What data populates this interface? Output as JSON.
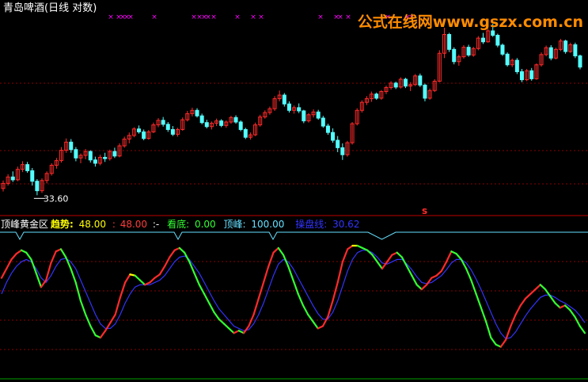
{
  "header": {
    "title": "青岛啤酒(日线 对数)",
    "marker": "× ××××"
  },
  "watermark": "公式在线网www.gszx.com.cn",
  "price_panel": {
    "low_label": "33.60",
    "signal_label": "s"
  },
  "indicator_panel": {
    "name": "顶峰黄金区",
    "items": [
      {
        "label": "趋势:",
        "value": "48.00",
        "color": "#ffff00"
      },
      {
        "label": ":",
        "value": "48.00",
        "color": "#ff3b3b"
      },
      {
        "label": ":-",
        "value": "",
        "color": "#ffffff"
      },
      {
        "label": "看底:",
        "value": "0.00",
        "color": "#33ff33"
      },
      {
        "label": "顶峰:",
        "value": "100.00",
        "color": "#66e0ff"
      },
      {
        "label": "操盘线:",
        "value": "30.62",
        "color": "#3333ff"
      }
    ]
  },
  "colors": {
    "up": "#ff2b2b",
    "down": "#54ffff",
    "grid": "#8b0000",
    "separator": "#c00000",
    "magenta": "#ff00ff",
    "watermark": "#ff8c00",
    "bottom_line": "#00a000"
  },
  "chart_data": [
    {
      "type": "candlestick",
      "title": "青岛啤酒(日线 对数)",
      "note": "Approximate daily candles; values in price units (log scale)",
      "candles": [
        [
          34.5,
          35.6,
          34.1,
          35.2
        ],
        [
          35.2,
          36.5,
          34.9,
          36.1
        ],
        [
          36.1,
          36.9,
          35.4,
          35.7
        ],
        [
          35.7,
          37.6,
          35.5,
          37.2
        ],
        [
          37.2,
          38.4,
          36.8,
          37.9
        ],
        [
          37.9,
          38.3,
          36.7,
          37.0
        ],
        [
          37.0,
          37.4,
          34.9,
          35.5
        ],
        [
          35.5,
          35.8,
          33.6,
          34.2
        ],
        [
          34.2,
          35.9,
          33.9,
          35.6
        ],
        [
          35.6,
          36.9,
          35.2,
          36.6
        ],
        [
          36.6,
          38.1,
          36.3,
          37.8
        ],
        [
          37.8,
          38.9,
          37.3,
          38.5
        ],
        [
          38.5,
          40.6,
          38.2,
          40.1
        ],
        [
          40.1,
          42.0,
          39.7,
          41.4
        ],
        [
          41.4,
          41.9,
          39.7,
          40.2
        ],
        [
          40.2,
          40.6,
          38.4,
          38.9
        ],
        [
          38.9,
          39.6,
          38.1,
          39.3
        ],
        [
          39.3,
          40.3,
          38.7,
          39.9
        ],
        [
          39.9,
          40.1,
          38.2,
          38.6
        ],
        [
          38.6,
          39.1,
          37.6,
          38.1
        ],
        [
          38.1,
          39.4,
          37.8,
          39.0
        ],
        [
          39.0,
          39.7,
          38.3,
          38.8
        ],
        [
          38.8,
          40.2,
          38.5,
          39.9
        ],
        [
          39.9,
          40.5,
          38.9,
          39.2
        ],
        [
          39.2,
          41.2,
          39.0,
          40.8
        ],
        [
          40.8,
          42.3,
          40.5,
          41.9
        ],
        [
          41.9,
          43.0,
          41.2,
          42.5
        ],
        [
          42.5,
          43.9,
          42.2,
          43.6
        ],
        [
          43.6,
          44.2,
          42.8,
          43.1
        ],
        [
          43.1,
          43.5,
          41.7,
          42.0
        ],
        [
          42.0,
          43.4,
          41.8,
          43.1
        ],
        [
          43.1,
          44.7,
          42.9,
          44.3
        ],
        [
          44.3,
          45.5,
          43.9,
          45.1
        ],
        [
          45.1,
          45.7,
          44.0,
          44.4
        ],
        [
          44.4,
          44.8,
          43.1,
          43.5
        ],
        [
          43.5,
          44.1,
          42.4,
          42.7
        ],
        [
          42.7,
          43.8,
          42.3,
          43.5
        ],
        [
          43.5,
          45.6,
          43.3,
          45.2
        ],
        [
          45.2,
          46.8,
          44.9,
          46.3
        ],
        [
          46.3,
          47.4,
          45.8,
          46.9
        ],
        [
          46.9,
          47.3,
          45.6,
          45.9
        ],
        [
          45.9,
          46.3,
          44.4,
          44.7
        ],
        [
          44.7,
          45.2,
          43.7,
          44.0
        ],
        [
          44.0,
          44.9,
          43.5,
          44.6
        ],
        [
          44.6,
          45.4,
          44.1,
          45.0
        ],
        [
          45.0,
          45.3,
          43.9,
          44.2
        ],
        [
          44.2,
          45.1,
          43.8,
          44.8
        ],
        [
          44.8,
          45.9,
          44.5,
          45.6
        ],
        [
          45.6,
          46.0,
          44.5,
          44.8
        ],
        [
          44.8,
          45.1,
          43.2,
          43.5
        ],
        [
          43.5,
          43.8,
          41.9,
          42.2
        ],
        [
          42.2,
          43.0,
          41.8,
          42.6
        ],
        [
          42.6,
          44.7,
          42.4,
          44.3
        ],
        [
          44.3,
          46.1,
          44.0,
          45.7
        ],
        [
          45.7,
          46.9,
          45.4,
          46.5
        ],
        [
          46.5,
          47.6,
          46.1,
          47.2
        ],
        [
          47.2,
          49.6,
          46.8,
          49.1
        ],
        [
          49.1,
          50.7,
          48.6,
          49.8
        ],
        [
          49.8,
          50.2,
          47.6,
          48.1
        ],
        [
          48.1,
          48.6,
          46.5,
          46.9
        ],
        [
          46.9,
          47.8,
          46.3,
          47.4
        ],
        [
          47.4,
          48.2,
          46.4,
          46.8
        ],
        [
          46.8,
          47.0,
          44.6,
          45.0
        ],
        [
          45.0,
          46.4,
          44.7,
          46.1
        ],
        [
          46.1,
          47.1,
          45.6,
          46.6
        ],
        [
          46.6,
          47.0,
          45.2,
          45.5
        ],
        [
          45.5,
          45.9,
          43.8,
          44.1
        ],
        [
          44.1,
          44.5,
          42.6,
          43.0
        ],
        [
          43.0,
          43.7,
          41.3,
          41.7
        ],
        [
          41.7,
          42.4,
          39.8,
          40.5
        ],
        [
          40.5,
          41.2,
          38.6,
          39.4
        ],
        [
          39.4,
          41.6,
          39.1,
          41.3
        ],
        [
          41.3,
          44.8,
          41.0,
          44.5
        ],
        [
          44.5,
          47.3,
          44.2,
          46.9
        ],
        [
          46.9,
          48.8,
          46.5,
          48.4
        ],
        [
          48.4,
          49.6,
          47.9,
          49.1
        ],
        [
          49.1,
          50.5,
          48.5,
          50.0
        ],
        [
          50.0,
          50.3,
          48.9,
          49.2
        ],
        [
          49.2,
          50.8,
          48.9,
          50.5
        ],
        [
          50.5,
          51.7,
          50.0,
          51.3
        ],
        [
          51.3,
          52.6,
          50.9,
          52.2
        ],
        [
          52.2,
          52.5,
          51.0,
          51.4
        ],
        [
          51.4,
          53.4,
          51.1,
          53.0
        ],
        [
          53.0,
          53.3,
          51.2,
          51.6
        ],
        [
          51.6,
          52.4,
          50.6,
          51.9
        ],
        [
          51.9,
          54.1,
          51.6,
          53.7
        ],
        [
          53.7,
          54.2,
          51.4,
          51.8
        ],
        [
          51.8,
          52.1,
          48.6,
          49.2
        ],
        [
          49.2,
          51.1,
          48.9,
          50.7
        ],
        [
          50.7,
          53.0,
          50.4,
          52.6
        ],
        [
          52.6,
          59.4,
          52.4,
          58.7
        ],
        [
          58.7,
          64.9,
          57.6,
          63.2
        ],
        [
          63.2,
          63.6,
          59.0,
          59.6
        ],
        [
          59.6,
          60.1,
          56.2,
          56.8
        ],
        [
          56.8,
          58.4,
          55.9,
          57.9
        ],
        [
          57.9,
          60.6,
          57.5,
          60.1
        ],
        [
          60.1,
          60.7,
          57.9,
          58.3
        ],
        [
          58.3,
          60.2,
          57.9,
          59.8
        ],
        [
          59.8,
          62.8,
          59.4,
          62.3
        ],
        [
          62.3,
          63.6,
          60.9,
          61.4
        ],
        [
          61.4,
          64.6,
          61.2,
          64.1
        ],
        [
          64.1,
          65.9,
          62.6,
          63.0
        ],
        [
          63.0,
          63.4,
          60.1,
          60.6
        ],
        [
          60.6,
          61.0,
          58.1,
          58.5
        ],
        [
          58.5,
          58.9,
          55.7,
          56.1
        ],
        [
          56.1,
          57.5,
          55.6,
          57.1
        ],
        [
          57.1,
          57.6,
          54.1,
          54.6
        ],
        [
          54.6,
          55.2,
          52.4,
          52.9
        ],
        [
          52.9,
          55.2,
          52.6,
          54.8
        ],
        [
          54.8,
          55.4,
          52.7,
          53.1
        ],
        [
          53.1,
          56.4,
          52.9,
          56.1
        ],
        [
          56.1,
          58.9,
          55.7,
          58.4
        ],
        [
          58.4,
          60.5,
          58.0,
          60.0
        ],
        [
          60.0,
          60.6,
          57.1,
          57.6
        ],
        [
          57.6,
          60.0,
          57.3,
          59.6
        ],
        [
          59.6,
          62.1,
          59.2,
          61.6
        ],
        [
          61.6,
          61.9,
          58.6,
          59.1
        ],
        [
          59.1,
          61.2,
          58.8,
          60.7
        ],
        [
          60.7,
          61.2,
          57.6,
          58.1
        ],
        [
          58.1,
          58.4,
          55.1,
          55.6
        ]
      ],
      "annotations": [
        {
          "text": "33.60",
          "kind": "low"
        },
        {
          "text": "s",
          "kind": "signal"
        }
      ]
    },
    {
      "type": "line",
      "title": "顶峰黄金区",
      "y_range": [
        0,
        100
      ],
      "series": [
        {
          "name": "趋势",
          "color_by": "direction",
          "colors": {
            "rising": "#ff2b2b",
            "falling": "#33ff33",
            "flat": "#ffff00"
          },
          "values": [
            72,
            80,
            88,
            93,
            96,
            94,
            88,
            76,
            64,
            70,
            85,
            95,
            97,
            90,
            80,
            68,
            52,
            40,
            30,
            22,
            20,
            26,
            33,
            40,
            55,
            68,
            75,
            74,
            70,
            66,
            68,
            72,
            75,
            82,
            90,
            96,
            98,
            94,
            86,
            76,
            66,
            58,
            50,
            42,
            36,
            32,
            28,
            24,
            26,
            24,
            30,
            40,
            54,
            68,
            82,
            94,
            98,
            92,
            82,
            70,
            58,
            48,
            40,
            34,
            28,
            30,
            38,
            52,
            68,
            86,
            97,
            100,
            100,
            98,
            96,
            92,
            86,
            80,
            86,
            92,
            94,
            90,
            82,
            74,
            66,
            62,
            66,
            72,
            74,
            78,
            86,
            95,
            93,
            88,
            80,
            70,
            58,
            46,
            34,
            20,
            14,
            12,
            18,
            30,
            40,
            48,
            54,
            58,
            62,
            66,
            62,
            56,
            50,
            46,
            48,
            44,
            38,
            30,
            24
          ]
        },
        {
          "name": "操盘线",
          "color": "#3333ff",
          "values": [
            58,
            68,
            76,
            82,
            86,
            88,
            86,
            80,
            72,
            68,
            74,
            82,
            88,
            89,
            86,
            80,
            70,
            60,
            50,
            40,
            32,
            28,
            28,
            32,
            40,
            50,
            58,
            64,
            66,
            66,
            66,
            68,
            70,
            74,
            80,
            86,
            90,
            91,
            88,
            82,
            76,
            68,
            60,
            52,
            45,
            40,
            35,
            30,
            28,
            26,
            27,
            32,
            40,
            50,
            62,
            74,
            84,
            88,
            86,
            80,
            72,
            64,
            56,
            48,
            41,
            36,
            36,
            42,
            52,
            65,
            78,
            88,
            94,
            96,
            96,
            94,
            90,
            85,
            84,
            86,
            88,
            88,
            84,
            79,
            73,
            68,
            67,
            68,
            71,
            74,
            79,
            85,
            88,
            88,
            85,
            79,
            71,
            62,
            52,
            42,
            32,
            24,
            19,
            20,
            25,
            32,
            39,
            45,
            50,
            55,
            57,
            57,
            55,
            52,
            50,
            47,
            44,
            39,
            33
          ]
        }
      ],
      "reference_levels": [
        20,
        40,
        60,
        80
      ]
    }
  ]
}
